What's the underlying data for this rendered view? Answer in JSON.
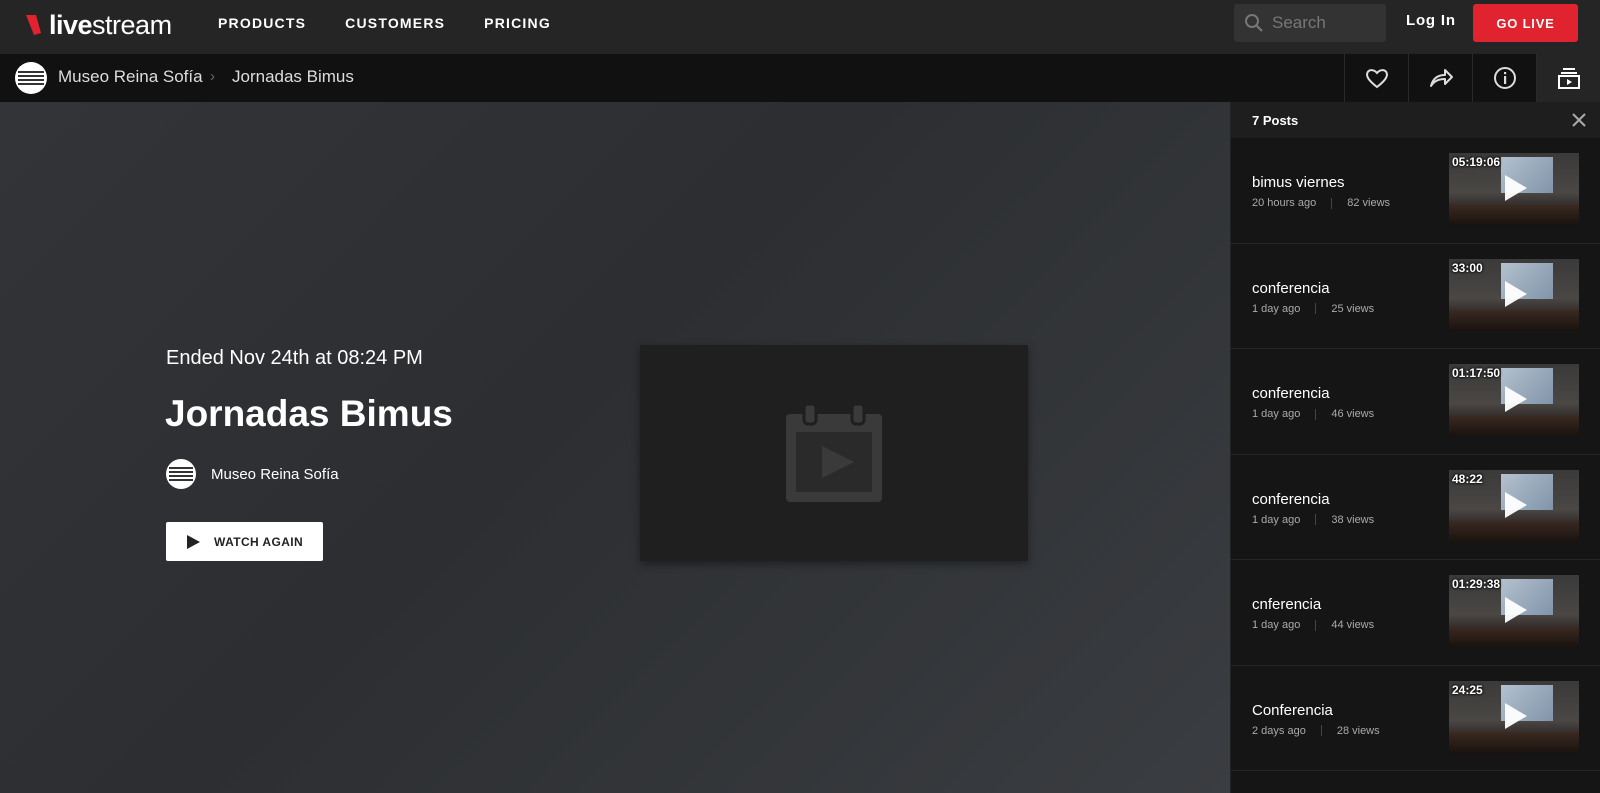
{
  "brand": {
    "logo_text_bold": "live",
    "logo_text_light": "stream",
    "accent": "#e0232f"
  },
  "nav": {
    "links": [
      "PRODUCTS",
      "CUSTOMERS",
      "PRICING"
    ],
    "search_placeholder": "Search",
    "login_label": "Log In",
    "golive_label": "GO LIVE"
  },
  "breadcrumb": {
    "channel": "Museo Reina Sofía",
    "event": "Jornadas Bimus"
  },
  "event": {
    "status": "Ended Nov 24th at 08:24 PM",
    "title": "Jornadas Bimus",
    "channel_name": "Museo Reina Sofía",
    "watch_again_label": "WATCH AGAIN"
  },
  "sidebar": {
    "header": "7 Posts",
    "posts": [
      {
        "title": "bimus viernes",
        "time": "20 hours ago",
        "views": "82 views",
        "duration": "05:19:06"
      },
      {
        "title": "conferencia",
        "time": "1 day ago",
        "views": "25 views",
        "duration": "33:00"
      },
      {
        "title": "conferencia",
        "time": "1 day ago",
        "views": "46 views",
        "duration": "01:17:50"
      },
      {
        "title": "conferencia",
        "time": "1 day ago",
        "views": "38 views",
        "duration": "48:22"
      },
      {
        "title": "cnferencia",
        "time": "1 day ago",
        "views": "44 views",
        "duration": "01:29:38"
      },
      {
        "title": "Conferencia",
        "time": "2 days ago",
        "views": "28 views",
        "duration": "24:25"
      }
    ]
  },
  "icons": {
    "sub_actions": [
      "heart-icon",
      "share-icon",
      "info-icon",
      "posts-panel-icon"
    ]
  }
}
